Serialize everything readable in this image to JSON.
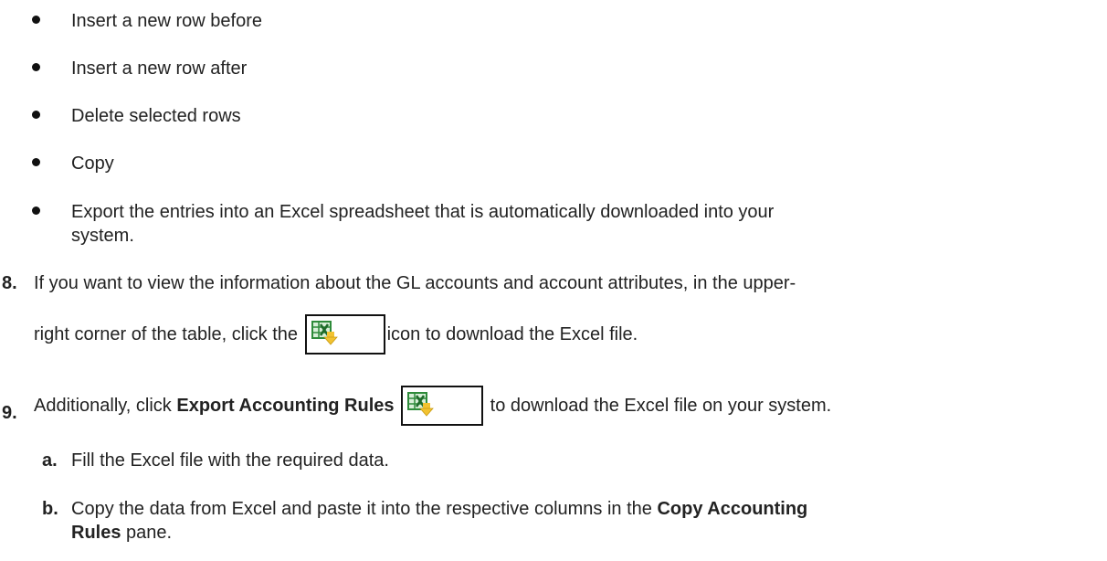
{
  "bullets": [
    "Insert a new row before",
    "Insert a new row after",
    "Delete selected rows",
    "Copy",
    "Export the entries into an Excel spreadsheet that is automatically downloaded into your"
  ],
  "bullet5_cont": "system.",
  "step8": {
    "num": "8.",
    "line1": "If you want to view the information about the GL accounts and account attributes, in the upper-",
    "line2_before": "right corner of the table, click the",
    "line2_after": "icon to download the Excel file."
  },
  "step9": {
    "num": "9.",
    "before": "Additionally, click ",
    "bold": "Export Accounting Rules",
    "after": "to download the Excel file on your system."
  },
  "sub_a": {
    "letter": "a.",
    "text": "Fill the Excel file with the required data."
  },
  "sub_b": {
    "letter": "b.",
    "before": "Copy the data from Excel and paste it into the respective columns in the ",
    "bold1": "Copy Accounting",
    "bold2": "Rules",
    "after": " pane."
  },
  "icons": {
    "excel_download": "excel-download-icon",
    "colors": {
      "excel_green": "#2e8b3a",
      "download_yellow": "#f2c230"
    }
  }
}
